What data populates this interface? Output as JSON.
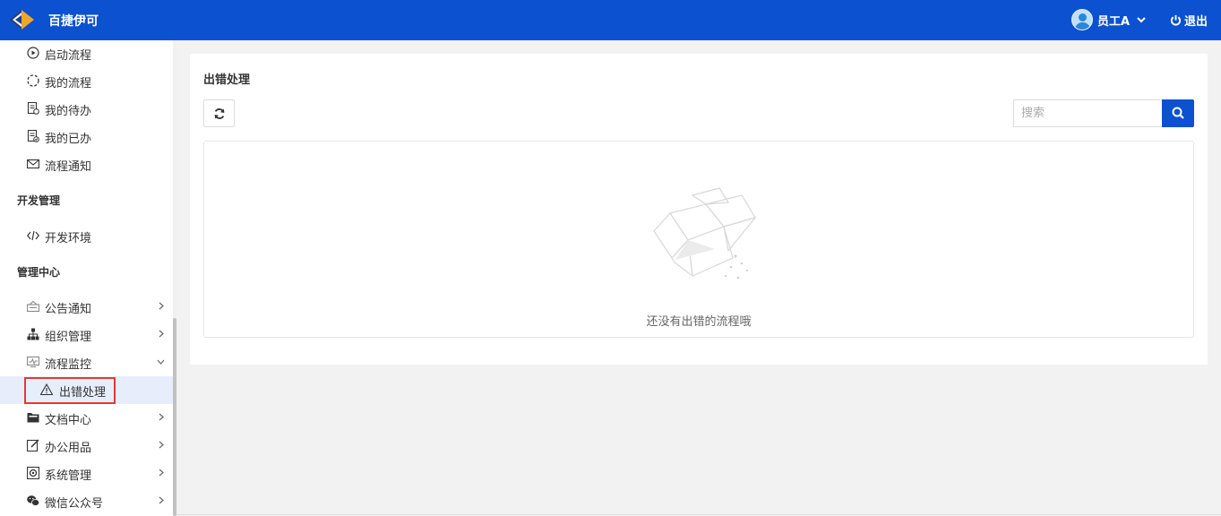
{
  "app": {
    "title": "百捷伊可"
  },
  "header": {
    "user_name": "员工A",
    "logout_label": "退出"
  },
  "sidebar": {
    "top_items": [
      {
        "label": "启动流程",
        "icon": "play-circle-icon"
      },
      {
        "label": "我的流程",
        "icon": "circle-dashed-icon"
      },
      {
        "label": "我的待办",
        "icon": "todo-doc-icon"
      },
      {
        "label": "我的已办",
        "icon": "done-doc-icon"
      },
      {
        "label": "流程通知",
        "icon": "envelope-icon"
      }
    ],
    "groups": [
      {
        "title": "开发管理"
      },
      {
        "title": "管理中心"
      }
    ],
    "dev_items": [
      {
        "label": "开发环境",
        "icon": "code-icon"
      }
    ],
    "mgmt_items": [
      {
        "label": "公告通知",
        "icon": "notice-icon",
        "expandable": true
      },
      {
        "label": "组织管理",
        "icon": "org-tree-icon",
        "expandable": true
      },
      {
        "label": "流程监控",
        "icon": "monitor-icon",
        "expanded": true
      },
      {
        "label": "出错处理",
        "icon": "warning-icon",
        "active": true
      },
      {
        "label": "文档中心",
        "icon": "folder-icon",
        "expandable": true
      },
      {
        "label": "办公用品",
        "icon": "edit-icon",
        "expandable": true
      },
      {
        "label": "系统管理",
        "icon": "settings-icon",
        "expandable": true
      },
      {
        "label": "微信公众号",
        "icon": "wechat-icon",
        "expandable": true
      }
    ]
  },
  "main": {
    "title": "出错处理",
    "search": {
      "placeholder": "搜索",
      "value": ""
    },
    "empty_text": "还没有出错的流程哦"
  },
  "colors": {
    "primary": "#0b51d0",
    "active_bg": "#e7edfb",
    "highlight": "#e53935"
  }
}
